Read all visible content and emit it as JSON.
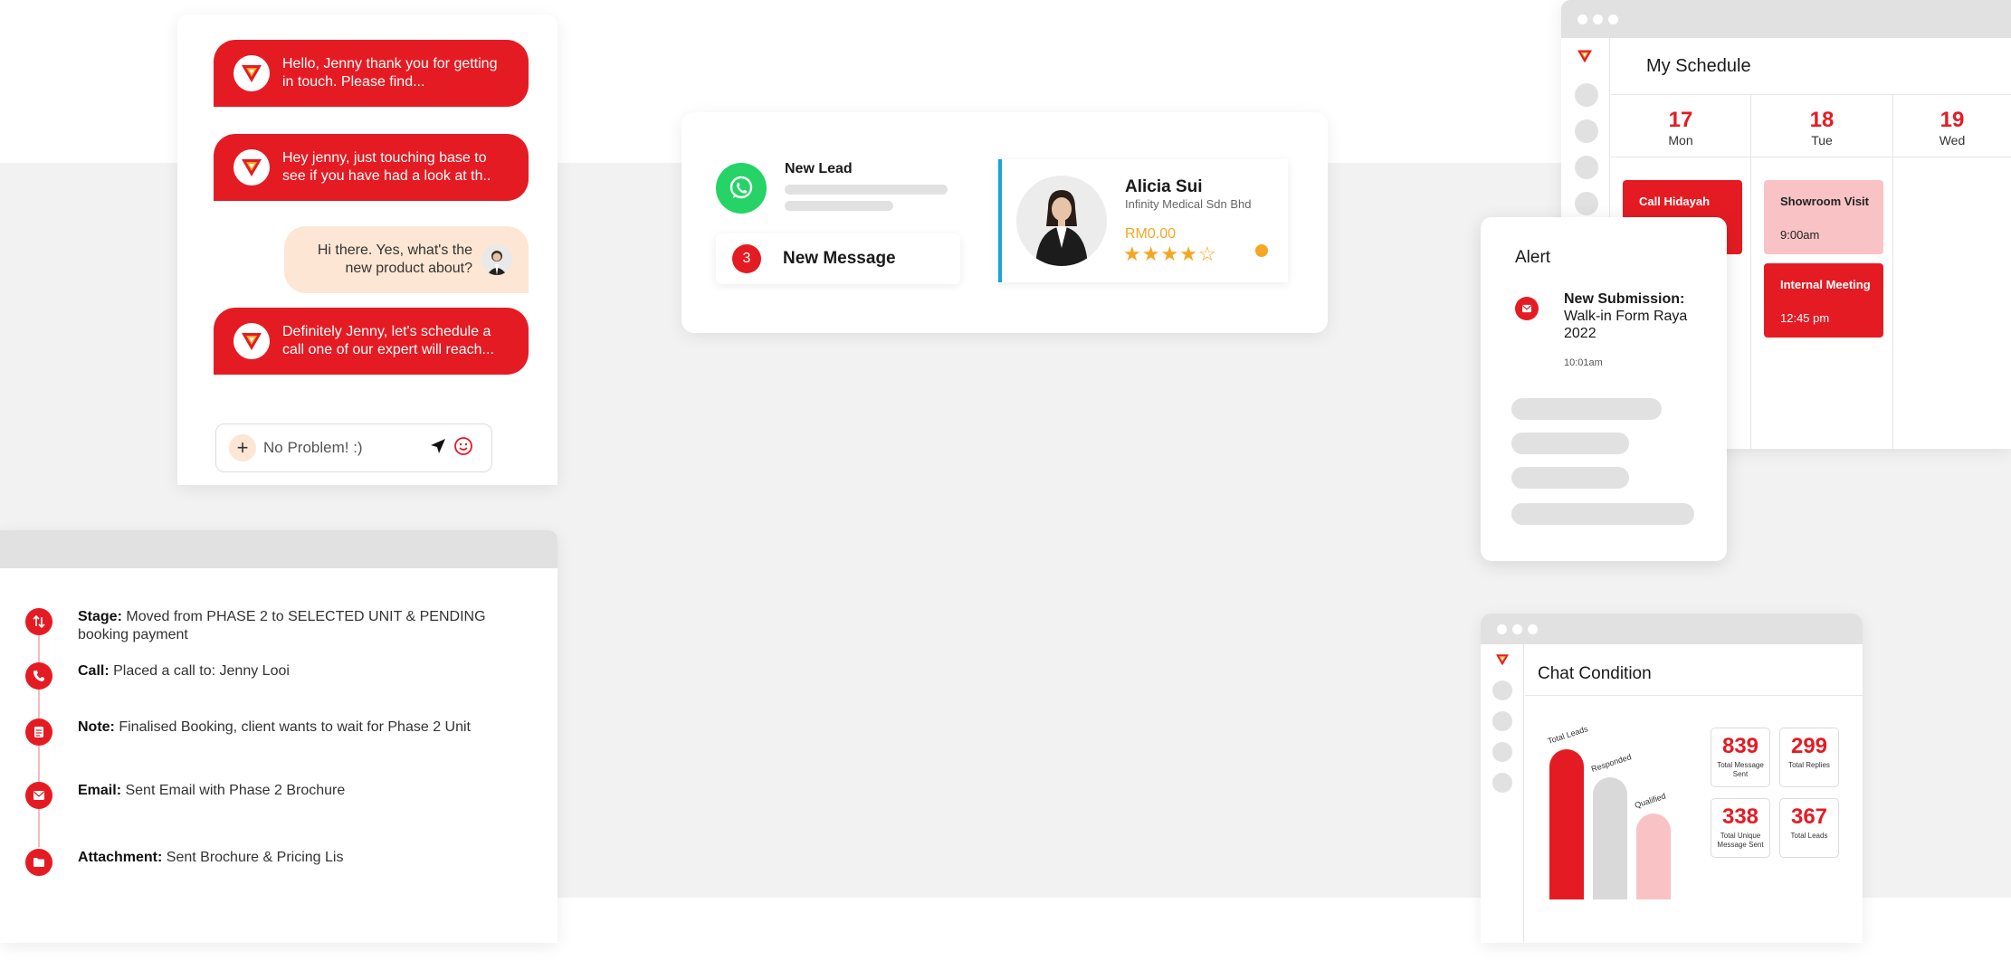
{
  "colors": {
    "brand_red": "#e51b23",
    "peach": "#fde6d3",
    "whatsapp_green": "#25d366",
    "accent_blue": "#1aa3d9",
    "star_orange": "#f5a623",
    "skeleton_gray": "#e1e1e1"
  },
  "chat": {
    "messages": [
      {
        "side": "agent",
        "text": "Hello, Jenny thank you for getting in touch. Please find..."
      },
      {
        "side": "agent",
        "text": "Hey jenny, just touching base to see if you have had a look at th.."
      },
      {
        "side": "customer",
        "text": "Hi there. Yes, what's the new product about?"
      },
      {
        "side": "agent",
        "text": "Definitely Jenny, let's schedule a call one of our expert will reach..."
      }
    ],
    "input": {
      "value": "No Problem! :)",
      "add_icon": "plus-icon",
      "send_icon": "send-icon",
      "emoji_icon": "smiley-icon"
    }
  },
  "timeline": {
    "items": [
      {
        "icon": "arrows-updown-icon",
        "label": "Stage:",
        "text": "Moved from PHASE 2 to SELECTED UNIT & PENDING booking payment"
      },
      {
        "icon": "phone-icon",
        "label": "Call:",
        "text": "Placed a call to: Jenny Looi"
      },
      {
        "icon": "note-icon",
        "label": "Note:",
        "text": "Finalised Booking, client wants to wait for Phase 2 Unit"
      },
      {
        "icon": "mail-icon",
        "label": "Email:",
        "text": "Sent Email with Phase 2 Brochure"
      },
      {
        "icon": "folder-icon",
        "label": "Attachment:",
        "text": "Sent Brochure & Pricing Lis"
      }
    ]
  },
  "lead_card": {
    "new_lead_label": "New Lead",
    "message_count": "3",
    "message_label": "New Message",
    "contact": {
      "name": "Alicia Sui",
      "company": "Infinity Medical Sdn Bhd",
      "value": "RM0.00",
      "rating": 4,
      "rating_max": 5
    }
  },
  "schedule": {
    "title": "My Schedule",
    "days": [
      {
        "num": "17",
        "name": "Mon"
      },
      {
        "num": "18",
        "name": "Tue"
      },
      {
        "num": "19",
        "name": "Wed"
      }
    ],
    "events": [
      {
        "title": "Call Hidayah",
        "time": ""
      },
      {
        "title": "Showroom Visit",
        "time": "9:00am"
      },
      {
        "title": "Internal Meeting",
        "time": "12:45 pm"
      }
    ]
  },
  "alert": {
    "title": "Alert",
    "heading": "New Submission:",
    "subject": "Walk-in Form Raya 2022",
    "time": "10:01am"
  },
  "chat_condition": {
    "title": "Chat Condition",
    "stats": [
      {
        "value": "839",
        "label": "Total Message Sent"
      },
      {
        "value": "299",
        "label": "Total Replies"
      },
      {
        "value": "338",
        "label": "Total Unique Message Sent"
      },
      {
        "value": "367",
        "label": "Total Leads"
      }
    ]
  },
  "chart_data": {
    "type": "bar",
    "categories": [
      "Total Leads",
      "Responded",
      "Qualified"
    ],
    "values": [
      367,
      299,
      210
    ],
    "colors": [
      "#e51b23",
      "#d9d9d9",
      "#f9c3c6"
    ]
  }
}
